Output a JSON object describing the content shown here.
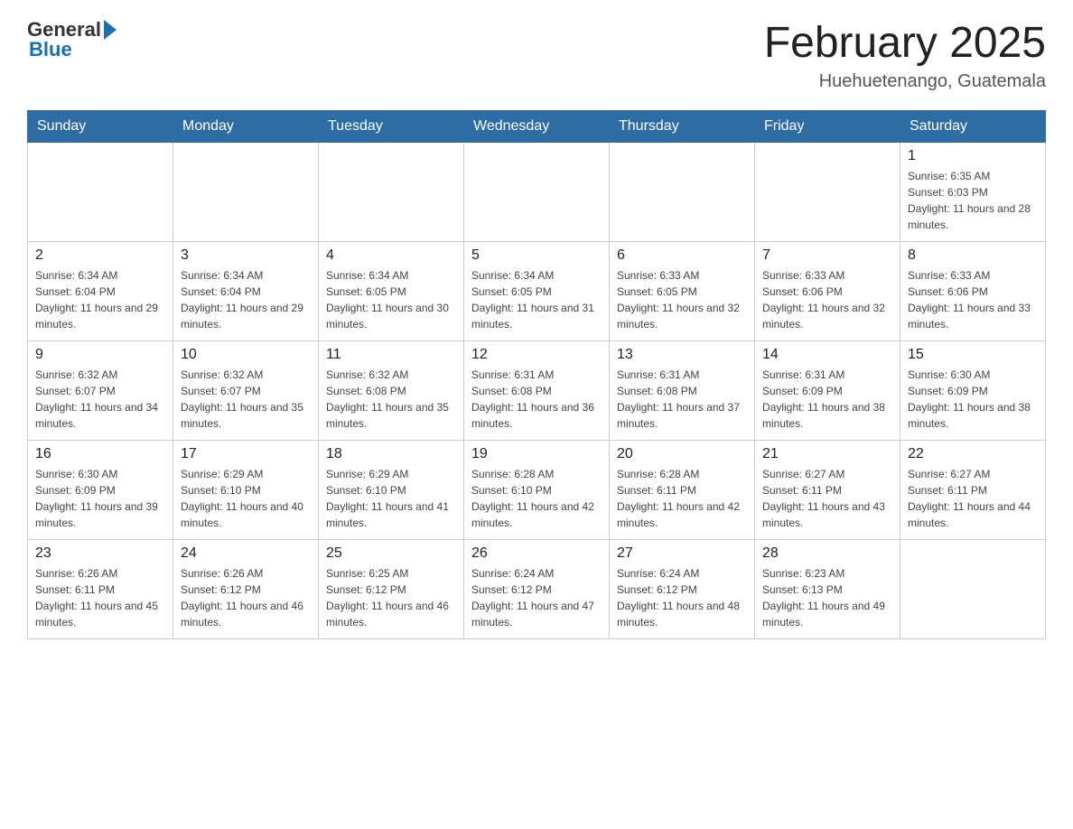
{
  "header": {
    "logo": {
      "general": "General",
      "blue": "Blue"
    },
    "title": "February 2025",
    "location": "Huehuetenango, Guatemala"
  },
  "weekdays": [
    "Sunday",
    "Monday",
    "Tuesday",
    "Wednesday",
    "Thursday",
    "Friday",
    "Saturday"
  ],
  "weeks": [
    {
      "days": [
        {
          "number": "",
          "info": ""
        },
        {
          "number": "",
          "info": ""
        },
        {
          "number": "",
          "info": ""
        },
        {
          "number": "",
          "info": ""
        },
        {
          "number": "",
          "info": ""
        },
        {
          "number": "",
          "info": ""
        },
        {
          "number": "1",
          "info": "Sunrise: 6:35 AM\nSunset: 6:03 PM\nDaylight: 11 hours and 28 minutes."
        }
      ]
    },
    {
      "days": [
        {
          "number": "2",
          "info": "Sunrise: 6:34 AM\nSunset: 6:04 PM\nDaylight: 11 hours and 29 minutes."
        },
        {
          "number": "3",
          "info": "Sunrise: 6:34 AM\nSunset: 6:04 PM\nDaylight: 11 hours and 29 minutes."
        },
        {
          "number": "4",
          "info": "Sunrise: 6:34 AM\nSunset: 6:05 PM\nDaylight: 11 hours and 30 minutes."
        },
        {
          "number": "5",
          "info": "Sunrise: 6:34 AM\nSunset: 6:05 PM\nDaylight: 11 hours and 31 minutes."
        },
        {
          "number": "6",
          "info": "Sunrise: 6:33 AM\nSunset: 6:05 PM\nDaylight: 11 hours and 32 minutes."
        },
        {
          "number": "7",
          "info": "Sunrise: 6:33 AM\nSunset: 6:06 PM\nDaylight: 11 hours and 32 minutes."
        },
        {
          "number": "8",
          "info": "Sunrise: 6:33 AM\nSunset: 6:06 PM\nDaylight: 11 hours and 33 minutes."
        }
      ]
    },
    {
      "days": [
        {
          "number": "9",
          "info": "Sunrise: 6:32 AM\nSunset: 6:07 PM\nDaylight: 11 hours and 34 minutes."
        },
        {
          "number": "10",
          "info": "Sunrise: 6:32 AM\nSunset: 6:07 PM\nDaylight: 11 hours and 35 minutes."
        },
        {
          "number": "11",
          "info": "Sunrise: 6:32 AM\nSunset: 6:08 PM\nDaylight: 11 hours and 35 minutes."
        },
        {
          "number": "12",
          "info": "Sunrise: 6:31 AM\nSunset: 6:08 PM\nDaylight: 11 hours and 36 minutes."
        },
        {
          "number": "13",
          "info": "Sunrise: 6:31 AM\nSunset: 6:08 PM\nDaylight: 11 hours and 37 minutes."
        },
        {
          "number": "14",
          "info": "Sunrise: 6:31 AM\nSunset: 6:09 PM\nDaylight: 11 hours and 38 minutes."
        },
        {
          "number": "15",
          "info": "Sunrise: 6:30 AM\nSunset: 6:09 PM\nDaylight: 11 hours and 38 minutes."
        }
      ]
    },
    {
      "days": [
        {
          "number": "16",
          "info": "Sunrise: 6:30 AM\nSunset: 6:09 PM\nDaylight: 11 hours and 39 minutes."
        },
        {
          "number": "17",
          "info": "Sunrise: 6:29 AM\nSunset: 6:10 PM\nDaylight: 11 hours and 40 minutes."
        },
        {
          "number": "18",
          "info": "Sunrise: 6:29 AM\nSunset: 6:10 PM\nDaylight: 11 hours and 41 minutes."
        },
        {
          "number": "19",
          "info": "Sunrise: 6:28 AM\nSunset: 6:10 PM\nDaylight: 11 hours and 42 minutes."
        },
        {
          "number": "20",
          "info": "Sunrise: 6:28 AM\nSunset: 6:11 PM\nDaylight: 11 hours and 42 minutes."
        },
        {
          "number": "21",
          "info": "Sunrise: 6:27 AM\nSunset: 6:11 PM\nDaylight: 11 hours and 43 minutes."
        },
        {
          "number": "22",
          "info": "Sunrise: 6:27 AM\nSunset: 6:11 PM\nDaylight: 11 hours and 44 minutes."
        }
      ]
    },
    {
      "days": [
        {
          "number": "23",
          "info": "Sunrise: 6:26 AM\nSunset: 6:11 PM\nDaylight: 11 hours and 45 minutes."
        },
        {
          "number": "24",
          "info": "Sunrise: 6:26 AM\nSunset: 6:12 PM\nDaylight: 11 hours and 46 minutes."
        },
        {
          "number": "25",
          "info": "Sunrise: 6:25 AM\nSunset: 6:12 PM\nDaylight: 11 hours and 46 minutes."
        },
        {
          "number": "26",
          "info": "Sunrise: 6:24 AM\nSunset: 6:12 PM\nDaylight: 11 hours and 47 minutes."
        },
        {
          "number": "27",
          "info": "Sunrise: 6:24 AM\nSunset: 6:12 PM\nDaylight: 11 hours and 48 minutes."
        },
        {
          "number": "28",
          "info": "Sunrise: 6:23 AM\nSunset: 6:13 PM\nDaylight: 11 hours and 49 minutes."
        },
        {
          "number": "",
          "info": ""
        }
      ]
    }
  ]
}
